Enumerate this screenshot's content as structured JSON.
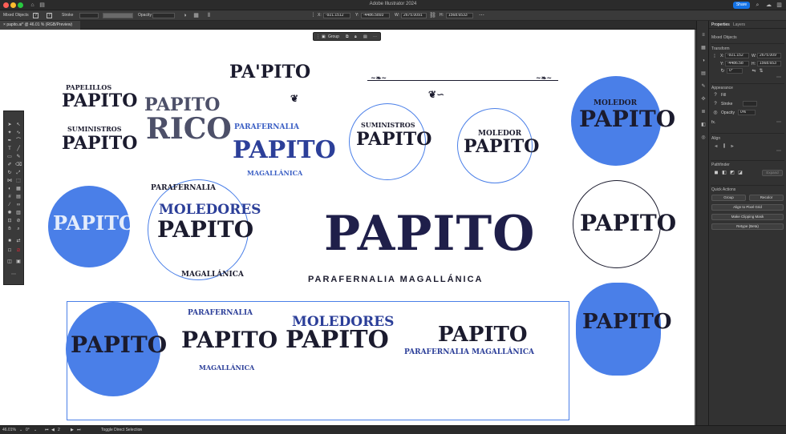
{
  "window": {
    "title": "Adobe Illustrator 2024",
    "share_label": "Share"
  },
  "controlbar": {
    "selection_type": "Mixed Objects",
    "stroke_label": "Stroke",
    "opacity_label": "Opacity",
    "x_value": "-921.1512",
    "y_value": "-4486.5893",
    "w_value": "2675.0091",
    "h_value": "1568.6533"
  },
  "document": {
    "tab_label": "papito.ai* @ 46.01 % (RGB/Preview)"
  },
  "context_bar": {
    "group_label": "Group"
  },
  "panel": {
    "tab_properties": "Properties",
    "tab_layers": "Layers",
    "selection_type": "Mixed Objects",
    "transform_label": "Transform",
    "x_value": "-921.152",
    "y_value": "-4486.58",
    "w_value": "2675.009",
    "h_value": "1568.653",
    "rotate_value": "0°",
    "appearance_label": "Appearance",
    "fill_label": "Fill",
    "stroke_label": "Stroke",
    "opacity_label": "Opacity",
    "opacity_value": "0%",
    "fx_label": "fx.",
    "align_label": "Align",
    "pathfinder_label": "Pathfinder",
    "expand_label": "Expand",
    "quick_actions_label": "Quick Actions",
    "group_button": "Group",
    "recolor_button": "Recolor",
    "align_pixel_button": "Align to Pixel Grid",
    "clipping_mask_button": "Make Clipping Mask",
    "retype_button": "Retype (Beta)"
  },
  "statusbar": {
    "zoom": "46.01%",
    "rotation": "0°",
    "artboard_index": "2",
    "hint": "Toggle Direct Selection"
  },
  "artwork": {
    "logo_papelillos": "PAPELILLOS",
    "logo_papito": "PAPITO",
    "logo_suministros": "SUMINISTROS",
    "logo_rico": "RICO",
    "logo_parafernalia": "PARAFERNALIA",
    "logo_magallanica": "MAGALLÁNICA",
    "logo_moledor": "MOLEDOR",
    "logo_moledores": "MOLEDORES",
    "tagline": "PARAFERNALIA MAGALLÁNICA",
    "papito_apostrophe": "PA'PITO"
  },
  "colors": {
    "accent": "#1473e6",
    "selection": "#4a7fe8",
    "ink": "#1b1b2e",
    "slate": "#4d5069"
  }
}
